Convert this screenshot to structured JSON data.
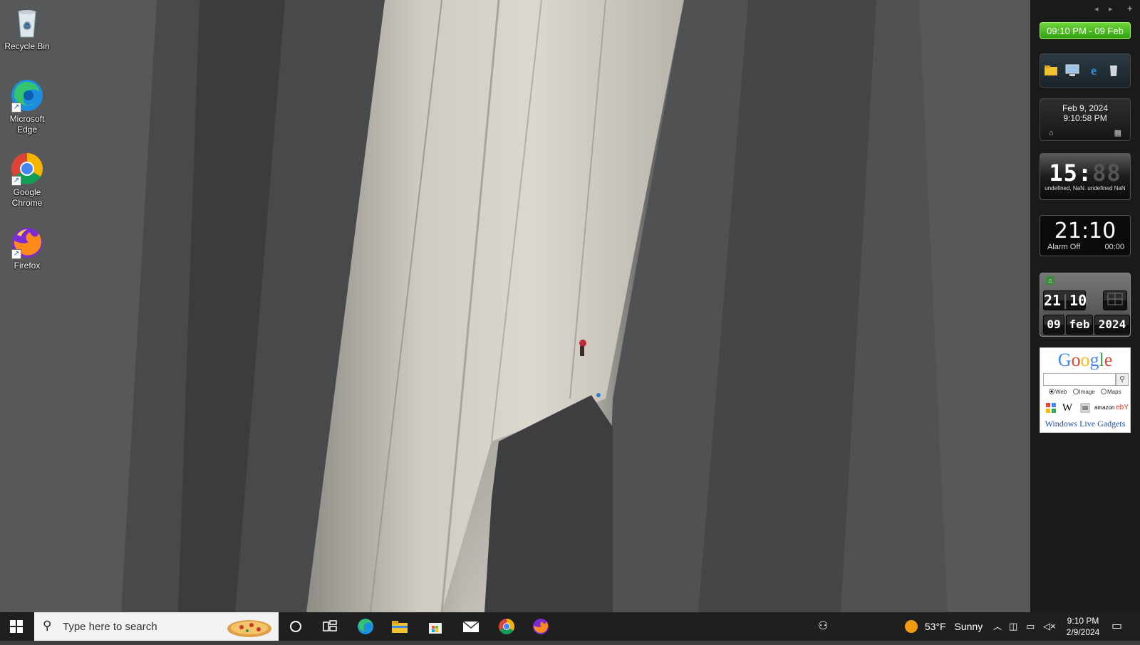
{
  "desktop_icons": [
    {
      "label": "Recycle Bin",
      "icon": "recycle-bin-icon"
    },
    {
      "label": "Microsoft Edge",
      "icon": "edge-icon"
    },
    {
      "label": "Google Chrome",
      "icon": "chrome-icon"
    },
    {
      "label": "Firefox",
      "icon": "firefox-icon"
    }
  ],
  "sidebar": {
    "time_banner": "09:10 PM - 09 Feb",
    "date_time_gadget": {
      "date": "Feb 9, 2024",
      "time": "9:10:58 PM"
    },
    "digital_clock": {
      "hours": "15",
      "minutes": "88",
      "caption": "undefined, NaN. undefined NaN"
    },
    "alarm_clock": {
      "time": "21:10",
      "status": "Alarm Off",
      "alarm_time": "00:00"
    },
    "flip_clock": {
      "hour": "21",
      "minute": "10",
      "day": "09",
      "month": "feb",
      "year": "2024"
    },
    "google_gadget": {
      "logo": "Google",
      "search_value": "",
      "radio_options": [
        "Web",
        "Image",
        "Maps"
      ],
      "selected_option": "Web",
      "links": [
        "W",
        "amazon",
        "ebY"
      ],
      "footer": "Windows Live Gadgets"
    }
  },
  "taskbar": {
    "search_placeholder": "Type here to search",
    "weather": {
      "temp": "53°F",
      "condition": "Sunny"
    },
    "clock": {
      "time": "9:10 PM",
      "date": "2/9/2024"
    }
  },
  "colors": {
    "taskbar_bg": "#1f1f1f",
    "banner_green": "#3fb51a",
    "google_blue": "#4285f4",
    "google_red": "#ea4335",
    "google_yellow": "#fbbc05",
    "google_green": "#34a853"
  }
}
